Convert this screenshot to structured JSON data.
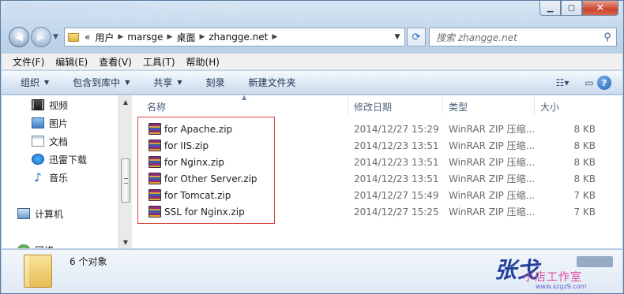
{
  "titlebar": {
    "minimize": "▁",
    "maximize": "▢",
    "close": "✕"
  },
  "nav": {
    "back_icon": "back-arrow-icon",
    "forward_icon": "forward-arrow-icon",
    "address": {
      "prefix": "«",
      "crumbs": [
        "用户",
        "marsge",
        "桌面",
        "zhangge.net"
      ]
    },
    "search_placeholder": "搜索 zhangge.net"
  },
  "menu": [
    "文件(F)",
    "编辑(E)",
    "查看(V)",
    "工具(T)",
    "帮助(H)"
  ],
  "commands": [
    {
      "label": "组织",
      "dropdown": true
    },
    {
      "label": "包含到库中",
      "dropdown": true
    },
    {
      "label": "共享",
      "dropdown": true
    },
    {
      "label": "刻录",
      "dropdown": false
    },
    {
      "label": "新建文件夹",
      "dropdown": false
    }
  ],
  "sidebar": {
    "items": [
      {
        "label": "视频",
        "icon": "video-library-icon"
      },
      {
        "label": "图片",
        "icon": "pictures-library-icon"
      },
      {
        "label": "文档",
        "icon": "documents-library-icon"
      },
      {
        "label": "迅雷下载",
        "icon": "thunder-download-icon"
      },
      {
        "label": "音乐",
        "icon": "music-library-icon"
      },
      {
        "label": "计算机",
        "icon": "computer-icon"
      },
      {
        "label": "网络",
        "icon": "network-icon"
      }
    ]
  },
  "columns": {
    "name": "名称",
    "date": "修改日期",
    "type": "类型",
    "size": "大小"
  },
  "files": [
    {
      "name": "for Apache.zip",
      "date": "2014/12/27 15:29",
      "type": "WinRAR ZIP 压缩...",
      "size": "8 KB"
    },
    {
      "name": "for IIS.zip",
      "date": "2014/12/23 13:51",
      "type": "WinRAR ZIP 压缩...",
      "size": "8 KB"
    },
    {
      "name": "for Nginx.zip",
      "date": "2014/12/23 13:51",
      "type": "WinRAR ZIP 压缩...",
      "size": "8 KB"
    },
    {
      "name": "for Other Server.zip",
      "date": "2014/12/23 13:51",
      "type": "WinRAR ZIP 压缩...",
      "size": "8 KB"
    },
    {
      "name": "for Tomcat.zip",
      "date": "2014/12/27 15:49",
      "type": "WinRAR ZIP 压缩...",
      "size": "7 KB"
    },
    {
      "name": "SSL for Nginx.zip",
      "date": "2014/12/27 15:25",
      "type": "WinRAR ZIP 压缩...",
      "size": "7 KB"
    }
  ],
  "details": {
    "count": "6 个对象"
  },
  "watermark": {
    "main": "张戈",
    "sub": "小店工作室",
    "url": "www.xzgz9.com"
  },
  "colors": {
    "highlight_border": "#d9413a",
    "window_chrome": "#c7daee",
    "accent": "#2a67b8"
  }
}
